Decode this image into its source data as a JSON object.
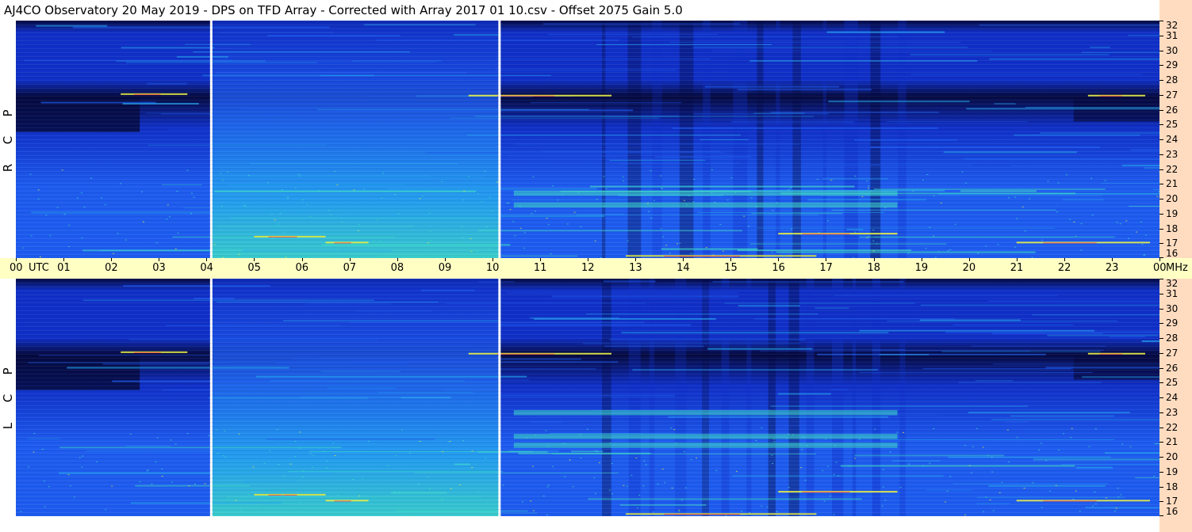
{
  "window": {
    "title": "AJ4CO Observatory  20 May 2019  -  DPS on TFD Array  -  Corrected with Array 2017 01 10.csv  -  Offset 2075  Gain 5.0"
  },
  "chart_data": [
    {
      "type": "heatmap",
      "panel": "RCP",
      "side_label": "R C P",
      "x_unit": "UTC",
      "x_ticks": [
        "00",
        "01",
        "02",
        "03",
        "04",
        "05",
        "06",
        "07",
        "08",
        "09",
        "10",
        "11",
        "12",
        "13",
        "14",
        "15",
        "16",
        "17",
        "18",
        "19",
        "20",
        "21",
        "22",
        "23",
        "00"
      ],
      "x_range_hours": [
        0,
        24
      ],
      "y_unit": "MHz",
      "y_ticks": [
        16,
        17,
        18,
        19,
        20,
        21,
        22,
        23,
        24,
        25,
        26,
        27,
        28,
        29,
        30,
        31,
        32
      ],
      "y_range_mhz": [
        16,
        32
      ],
      "data_gaps_utc_hours": [
        4.1,
        10.15
      ],
      "colormap": [
        "#050a40",
        "#1030c8",
        "#1e5cf0",
        "#24a8f0",
        "#3ee0c8",
        "#e8f040",
        "#ff4040"
      ]
    },
    {
      "type": "heatmap",
      "panel": "LCP",
      "side_label": "L C P",
      "x_unit": "UTC",
      "x_ticks": [
        "00",
        "01",
        "02",
        "03",
        "04",
        "05",
        "06",
        "07",
        "08",
        "09",
        "10",
        "11",
        "12",
        "13",
        "14",
        "15",
        "16",
        "17",
        "18",
        "19",
        "20",
        "21",
        "22",
        "23",
        "00"
      ],
      "x_range_hours": [
        0,
        24
      ],
      "y_unit": "MHz",
      "y_ticks": [
        16,
        17,
        18,
        19,
        20,
        21,
        22,
        23,
        24,
        25,
        26,
        27,
        28,
        29,
        30,
        31,
        32
      ],
      "y_range_mhz": [
        16,
        32
      ],
      "data_gaps_utc_hours": [
        4.1,
        10.15
      ],
      "colormap": [
        "#050a40",
        "#1030c8",
        "#1e5cf0",
        "#24a8f0",
        "#3ee0c8",
        "#e8f040",
        "#ff4040"
      ]
    }
  ],
  "time_axis": {
    "unit_label": "UTC",
    "end_unit_label": "MHz"
  },
  "colors": {
    "axis_background_freq": "#ffdcc0",
    "axis_background_time": "#ffffc4",
    "gap_line": "#ffffff"
  }
}
